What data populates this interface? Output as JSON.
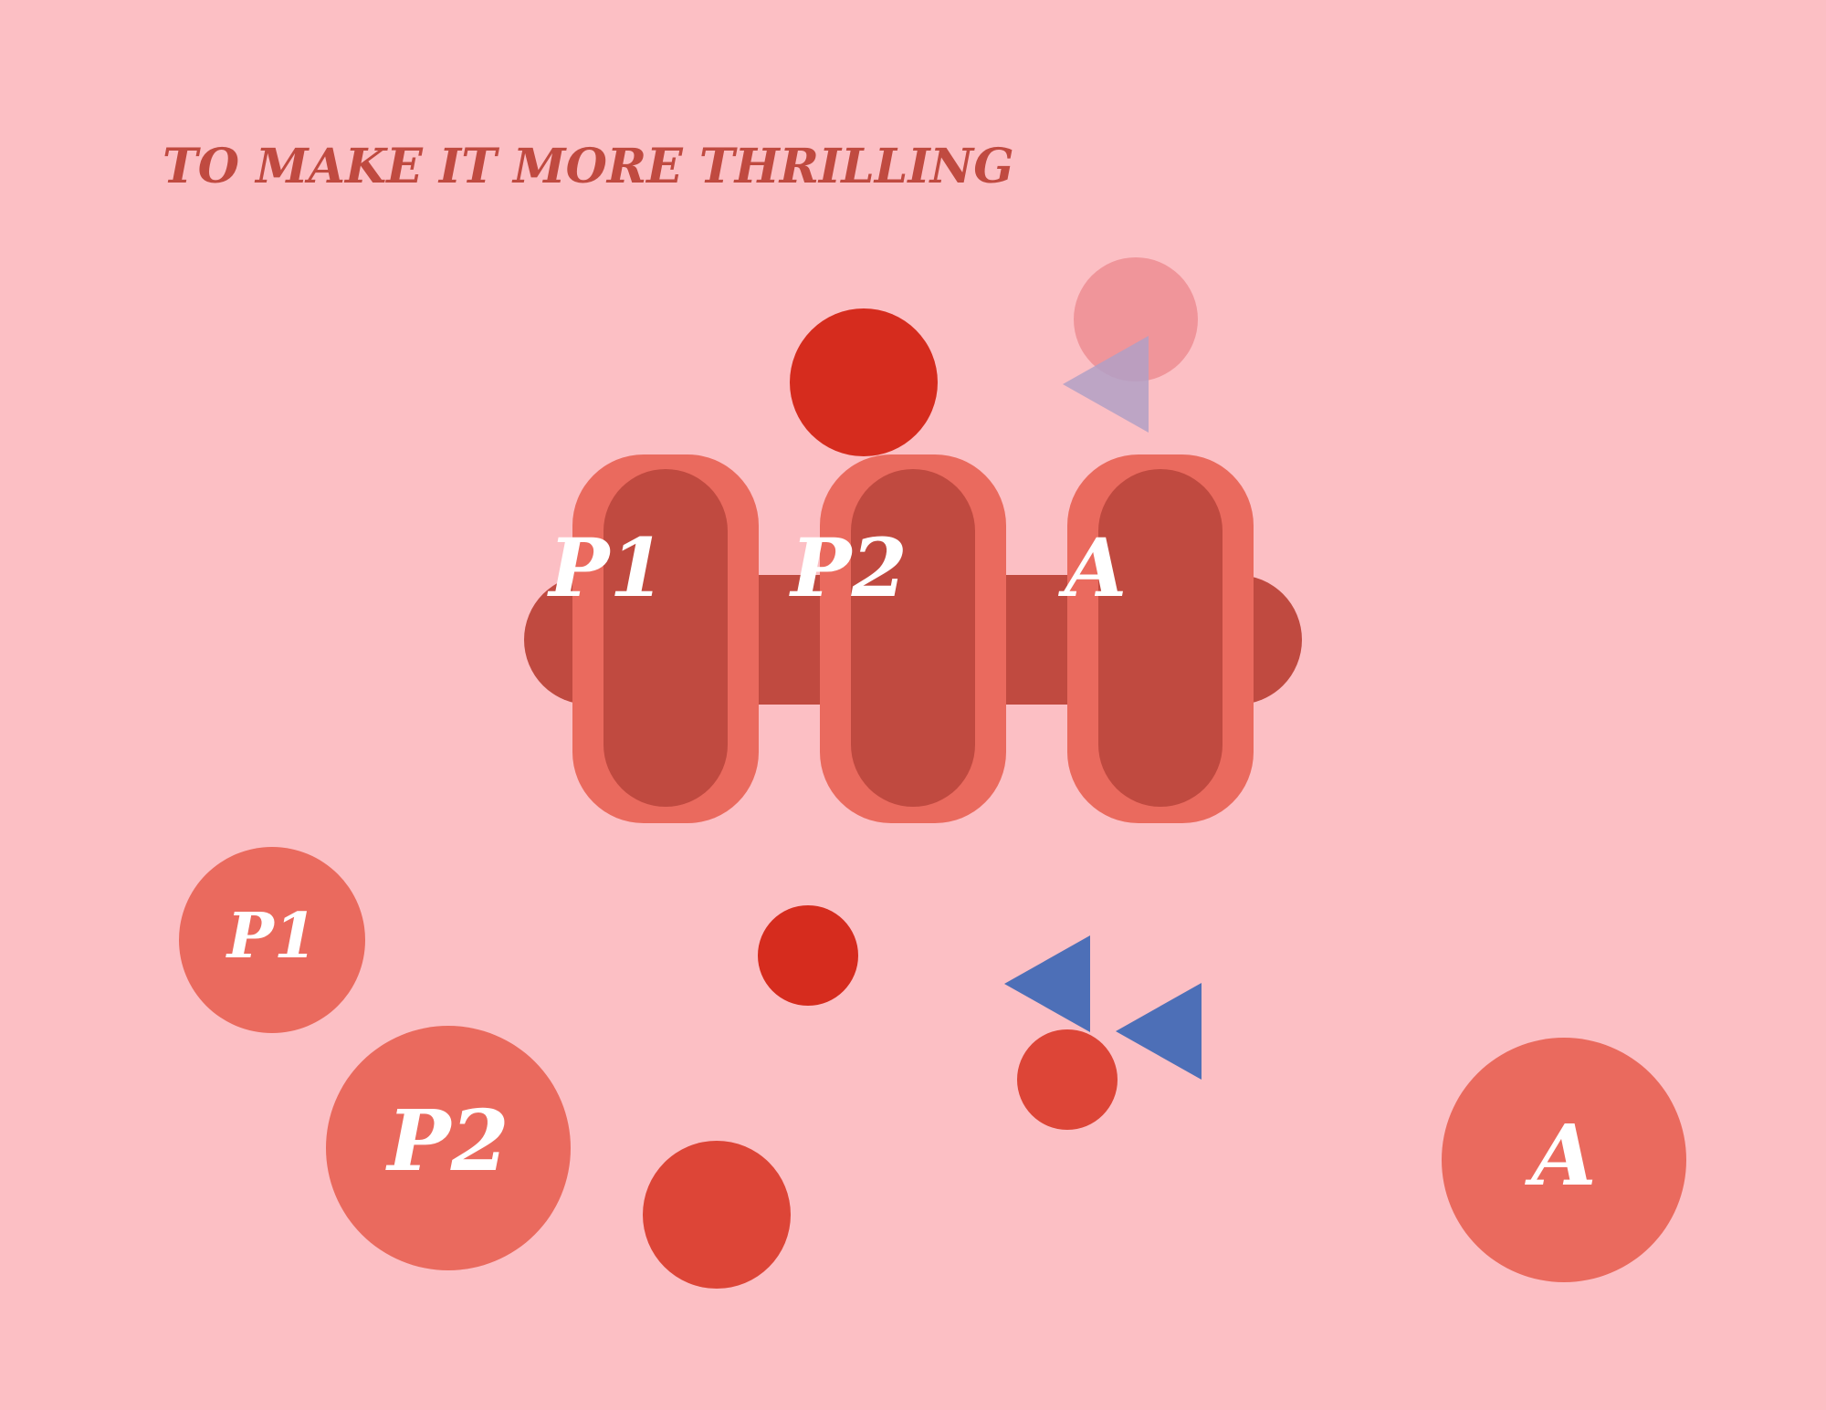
{
  "title": "TO MAKE IT MORE THRILLING",
  "colors": {
    "background": "#fcbfc4",
    "title": "#c04a40",
    "pill_outer": "#ea6a5e",
    "pill_inner": "#c04a40",
    "ball_red": "#d62c1e",
    "ball_coral": "#dd4537",
    "token": "#ea6a5e",
    "faded_ball": "#f0959a",
    "triangle_blue": "#4d6fb7",
    "triangle_faded": "#b1a0c6",
    "label": "#ffffff"
  },
  "lanes": [
    {
      "label": "P1"
    },
    {
      "label": "P2"
    },
    {
      "label": "A"
    }
  ],
  "tokens": [
    {
      "label": "P1"
    },
    {
      "label": "P2"
    },
    {
      "label": "A"
    }
  ],
  "icons": {
    "ball": "ball-icon",
    "arrow": "triangle-left-icon"
  }
}
